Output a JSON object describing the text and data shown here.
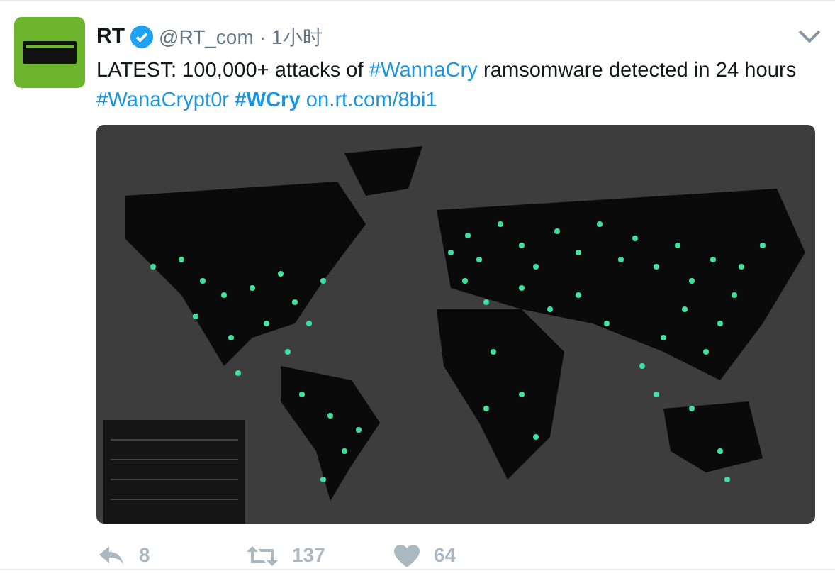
{
  "tweet": {
    "author": {
      "name": "RT",
      "verified": true,
      "handle": "@RT_com",
      "separator": "·",
      "time": "1小时"
    },
    "text": [
      {
        "kind": "text",
        "text": "LATEST: 100,000+ attacks of "
      },
      {
        "kind": "link",
        "text": "#WannaCry",
        "bold": false
      },
      {
        "kind": "text",
        "text": " ramsomware detected in 24 hours "
      },
      {
        "kind": "link",
        "text": "#WanaCrypt0r",
        "bold": false
      },
      {
        "kind": "link",
        "text": "#WCry",
        "bold": true
      },
      {
        "kind": "link",
        "text": "on.rt.com/8bi1",
        "bold": false
      }
    ],
    "actions": [
      {
        "kind": "reply",
        "count": "8"
      },
      {
        "kind": "retweet",
        "count": "137"
      },
      {
        "kind": "like",
        "count": "64"
      }
    ]
  }
}
